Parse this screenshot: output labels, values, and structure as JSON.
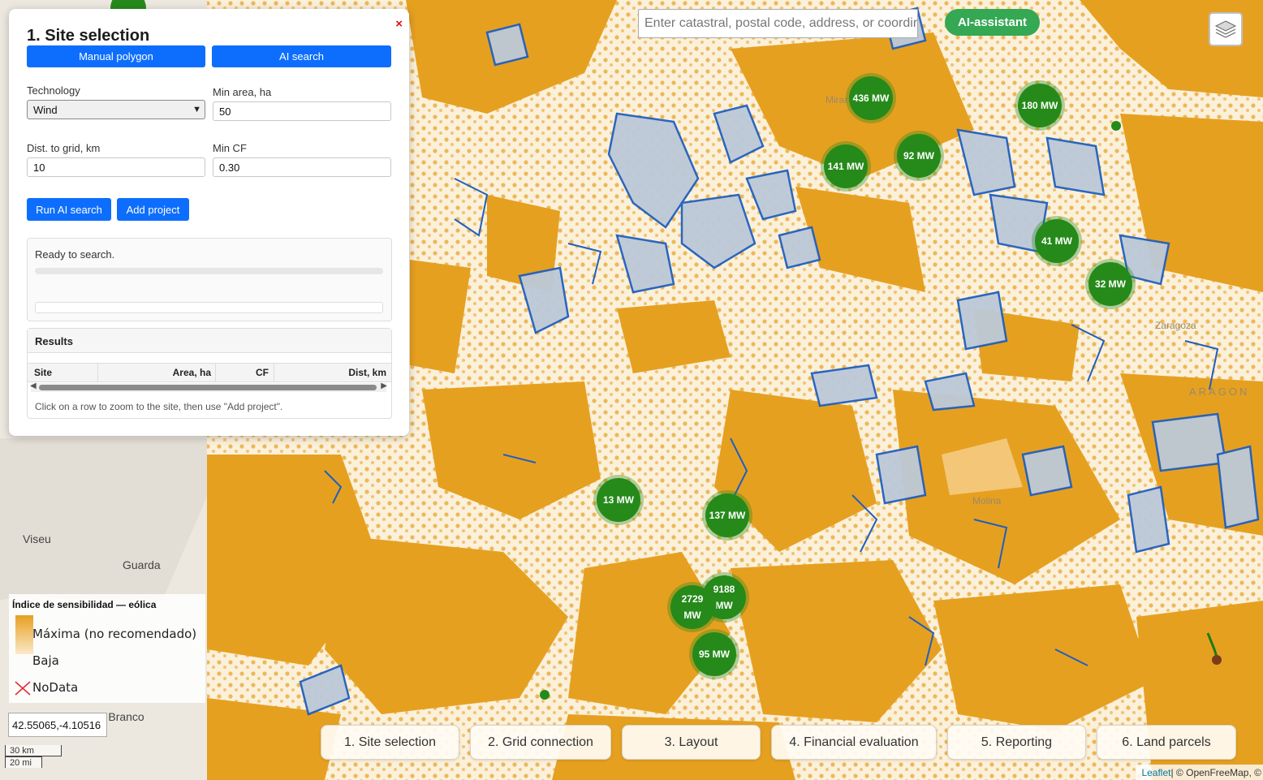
{
  "panel": {
    "title": "1. Site selection",
    "close_label": "×",
    "manual_polygon": "Manual polygon",
    "ai_search": "AI search",
    "technology_label": "Technology",
    "technology_value": "Wind",
    "min_area_label": "Min area, ha",
    "min_area_value": "50",
    "dist_grid_label": "Dist. to grid, km",
    "dist_grid_value": "10",
    "min_cf_label": "Min CF",
    "min_cf_value": "0.30",
    "run_ai_search": "Run AI search",
    "add_project": "Add project",
    "status": "Ready to search.",
    "results_title": "Results",
    "columns": [
      "Site",
      "Area, ha",
      "CF",
      "Dist, km"
    ],
    "hint": "Click on a row to zoom to the site, then use \"Add project\"."
  },
  "search": {
    "placeholder": "Enter catastral, postal code, address, or coordinates"
  },
  "ai_assistant": "AI-assistant",
  "clusters": [
    "436 MW",
    "180 MW",
    "92 MW",
    "141 MW",
    "41 MW",
    "32 MW",
    "13 MW",
    "137 MW",
    "9188 MW",
    "2729 MW",
    "95 MW"
  ],
  "legend": {
    "title": "Índice de sensibilidad — eólica",
    "max_label": "Máxima (no recomendado)",
    "low_label": "Baja",
    "nodata_label": "NoData"
  },
  "coords": "42.55065,-4.10516",
  "scale": {
    "km": "30 km",
    "mi": "20 mi"
  },
  "tabs": [
    "1. Site selection",
    "2. Grid connection",
    "3. Layout",
    "4. Financial evaluation",
    "5. Reporting",
    "6. Land parcels"
  ],
  "attribution": {
    "leaflet": "Leaflet",
    "rest": " | © OpenFreeMap, ©"
  },
  "map_labels": [
    "Viseu",
    "Guarda",
    "Castelo Branco",
    "Zaragoza",
    "ARAGON",
    "Molina",
    "Mirar"
  ],
  "colors": {
    "high_sensitivity": "#e6a020",
    "low_sensitivity": "#fbe9c8",
    "protected_area": "#1f5fbf",
    "cluster": "#258a1a",
    "button": "#0d6efd",
    "ai_button": "#34a853"
  }
}
